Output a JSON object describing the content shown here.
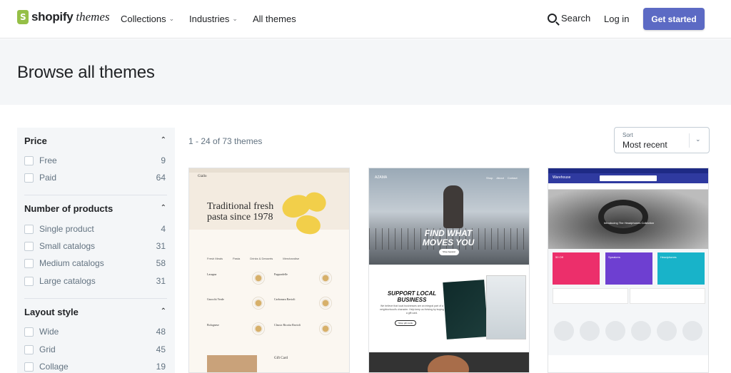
{
  "nav": {
    "logo_word1": "shopify",
    "logo_word2": "themes",
    "collections": "Collections",
    "industries": "Industries",
    "all_themes": "All themes",
    "search": "Search",
    "login": "Log in",
    "get_started": "Get started",
    "colors": {
      "accent": "#5c6ac4",
      "logo_green": "#95bf47"
    }
  },
  "hero": {
    "title": "Browse all themes"
  },
  "filters": {
    "price": {
      "title": "Price",
      "options": [
        {
          "label": "Free",
          "count": "9"
        },
        {
          "label": "Paid",
          "count": "64"
        }
      ]
    },
    "products": {
      "title": "Number of products",
      "options": [
        {
          "label": "Single product",
          "count": "4"
        },
        {
          "label": "Small catalogs",
          "count": "31"
        },
        {
          "label": "Medium catalogs",
          "count": "58"
        },
        {
          "label": "Large catalogs",
          "count": "31"
        }
      ]
    },
    "layout": {
      "title": "Layout style",
      "options": [
        {
          "label": "Wide",
          "count": "48"
        },
        {
          "label": "Grid",
          "count": "45"
        },
        {
          "label": "Collage",
          "count": "19"
        }
      ]
    }
  },
  "results": {
    "count_text": "1 - 24 of 73 themes"
  },
  "sort": {
    "label": "Sort",
    "value": "Most recent"
  },
  "themes": [
    {
      "brand": "Giallo",
      "headline": "Traditional fresh pasta since 1978",
      "tabs": [
        "Fresh Meals",
        "Pasta",
        "Drinks & Desserts",
        "Merchandise"
      ],
      "items": [
        "Lasagna",
        "Pappardelle",
        "Gnocchi Verde",
        "Carbonara Ravioli",
        "Bolognese",
        "Classic Ricotta Ravioli"
      ],
      "gift": "Gift Card"
    },
    {
      "brand": "AZAMA",
      "nav": [
        "Shop",
        "About",
        "Contact"
      ],
      "headline": "FIND WHAT MOVES YOU",
      "cta": "Shop Apparel",
      "section": "SUPPORT LOCAL BUSINESS",
      "section_text": "We believe that local businesses are an integral part of a neighborhood's character. Help keep us thriving by buying a gift card.",
      "section_cta": "Shop gift cards"
    },
    {
      "store": "Warehouse",
      "banner": "Introducing The Headphones Collection",
      "promos": [
        "50 Off",
        "Speakers",
        "Headphones"
      ]
    }
  ]
}
